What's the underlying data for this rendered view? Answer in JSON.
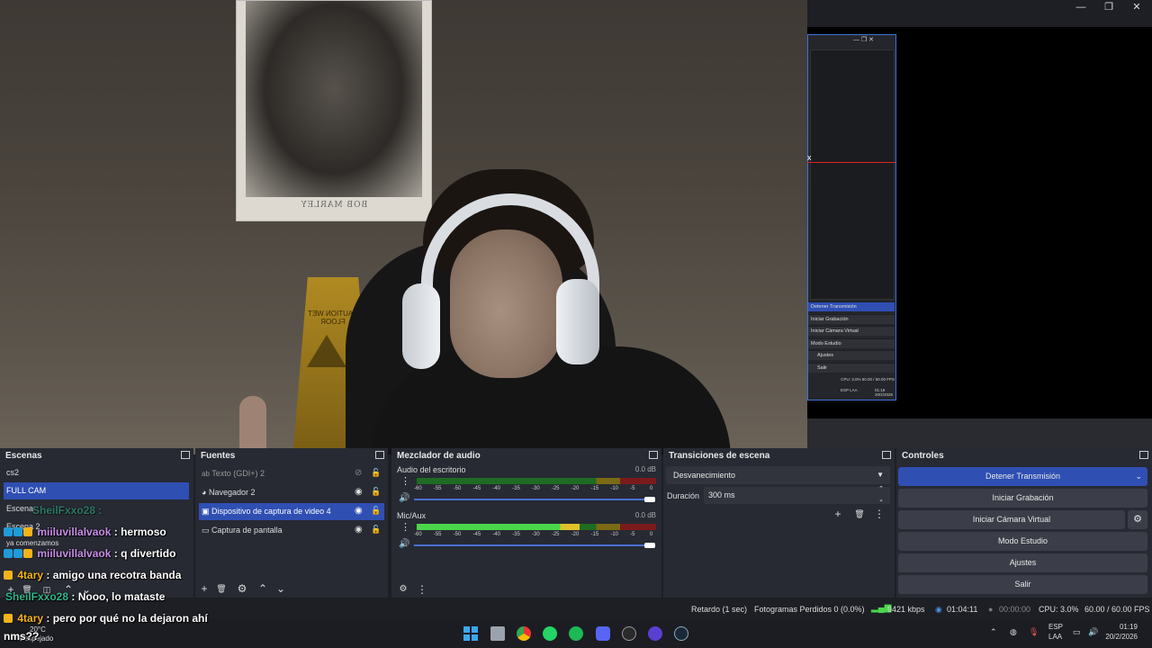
{
  "window": {
    "minimize": "—",
    "maximize": "❐",
    "close": "✕"
  },
  "webcam": {
    "poster_caption": "BOB MARLEY",
    "sign_text": "CAUTION WET FLOOR"
  },
  "mini_obs": {
    "rows": [
      "Detener Transmisión",
      "Iniciar Grabación",
      "Iniciar Cámara Virtual",
      "Modo Estudio",
      "Ajustes",
      "Salir"
    ],
    "status": "CPU: 3.0%   60.00 / 60.00 FPS",
    "clock": "01:19 20/2/2026",
    "lang": "ESP LAA"
  },
  "scenes": {
    "title": "Escenas",
    "items": [
      "cs2",
      "FULL CAM",
      "Escena",
      "Escena 2"
    ],
    "selected": 1,
    "weather_temp": "20°C",
    "weather_text": "Despejado",
    "stream_text": "ya comenzamos"
  },
  "sources": {
    "title": "Fuentes",
    "items": [
      {
        "label": "Texto (GDI+) 2",
        "icon": "text-icon",
        "visible": false
      },
      {
        "label": "Navegador 2",
        "icon": "browser-icon",
        "visible": true
      },
      {
        "label": "Dispositivo de captura de video 4",
        "icon": "camera-icon",
        "visible": true
      },
      {
        "label": "Captura de pantalla",
        "icon": "monitor-icon",
        "visible": true
      }
    ],
    "selected": 2
  },
  "mixer": {
    "title": "Mezclador de audio",
    "channels": [
      {
        "name": "Audio del escritorio",
        "db": "0.0 dB",
        "level": 0
      },
      {
        "name": "Mic/Aux",
        "db": "0.0 dB",
        "level": 0.68
      }
    ],
    "scale": [
      "-60",
      "-55",
      "-50",
      "-45",
      "-40",
      "-35",
      "-30",
      "-25",
      "-20",
      "-15",
      "-10",
      "-5",
      "0"
    ]
  },
  "transitions": {
    "title": "Transiciones de escena",
    "selected": "Desvanecimiento",
    "duration_label": "Duración",
    "duration_value": "300 ms"
  },
  "controls": {
    "title": "Controles",
    "stop_stream": "Detener Transmisión",
    "start_recording": "Iniciar Grabación",
    "start_virtual_cam": "Iniciar Cámara Virtual",
    "studio_mode": "Modo Estudio",
    "settings": "Ajustes",
    "exit": "Salir"
  },
  "status": {
    "delay": "Retardo (1 sec)",
    "dropped": "Fotogramas Perdidos 0 (0.0%)",
    "bitrate": "9421 kbps",
    "stream_time": "01:04:11",
    "record_time": "00:00:00",
    "cpu": "CPU: 3.0%",
    "fps": "60.00 / 60.00 FPS"
  },
  "chat": [
    {
      "user": "SheilFxxo28",
      "msg": "",
      "color": "#2fb58b",
      "badges": "none"
    },
    {
      "user": "miiluvillalvaok",
      "msg": "hermoso",
      "color": "#c98ce8",
      "badges": "multi"
    },
    {
      "user": "miiluvillalvaok",
      "msg": "q divertido",
      "color": "#c98ce8",
      "badges": "multi"
    },
    {
      "user": "4tary",
      "msg": "amigo una recotra banda",
      "color": "#f3b319",
      "badges": "one"
    },
    {
      "user": "SheilFxxo28",
      "msg": "Nooo, lo mataste",
      "color": "#2fb58b",
      "badges": "none"
    },
    {
      "user": "4tary",
      "msg": "pero por qué no la dejaron ahí",
      "color": "#f3b319",
      "badges": "one"
    },
    {
      "user": "",
      "msg": "nms??",
      "color": "#ffffff",
      "badges": "none"
    }
  ],
  "taskbar": {
    "lang": "ESP",
    "layout": "LAA",
    "time": "01:19",
    "date": "20/2/2026"
  }
}
